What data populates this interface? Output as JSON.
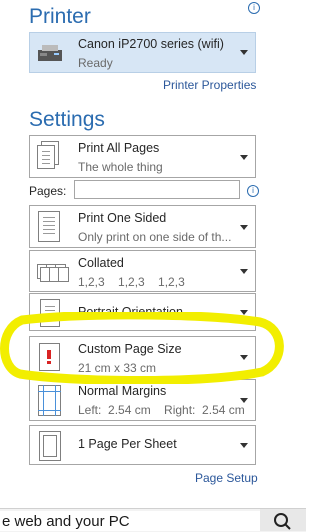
{
  "printer": {
    "section_title": "Printer",
    "name": "Canon iP2700 series (wifi)",
    "status": "Ready",
    "properties_link": "Printer Properties"
  },
  "settings": {
    "section_title": "Settings",
    "pages_label": "Pages:",
    "pages_value": "",
    "items": [
      {
        "main": "Print All Pages",
        "sub": "The whole thing"
      },
      {
        "main": "Print One Sided",
        "sub": "Only print on one side of th..."
      },
      {
        "main": "Collated",
        "sub": "1,2,3    1,2,3    1,2,3"
      },
      {
        "main": "Portrait Orientation",
        "sub": ""
      },
      {
        "main": "Custom Page Size",
        "sub": "21 cm x 33 cm"
      },
      {
        "main": "Normal Margins",
        "sub": "Left:  2.54 cm    Right:  2.54 cm"
      },
      {
        "main": "1 Page Per Sheet",
        "sub": ""
      }
    ],
    "page_setup_link": "Page Setup"
  },
  "taskbar": {
    "search_text": "e web and your PC"
  },
  "colors": {
    "accent": "#2b6cb0",
    "highlight": "#f2ee00",
    "selected_bg": "#d7e6f5"
  }
}
